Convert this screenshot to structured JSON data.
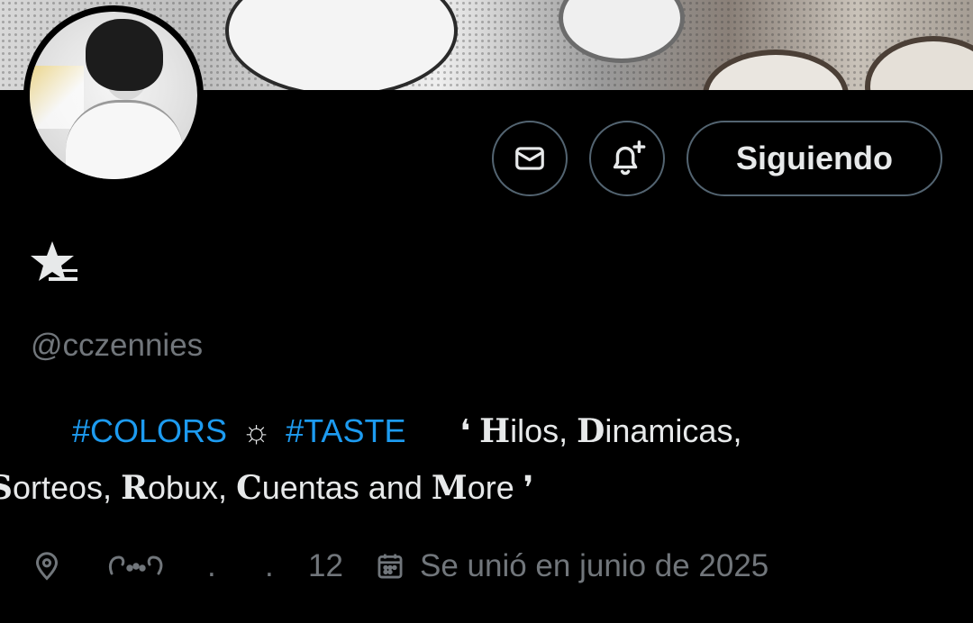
{
  "profile": {
    "display_name": "★",
    "handle": "@cczennies",
    "bio": {
      "tag1": "#COLORS",
      "separator": "☼",
      "tag2": "#TASTE",
      "open_quote": "❛",
      "line1_parts": [
        "H",
        "ilos, ",
        "D",
        "inamicas,"
      ],
      "line2_parts": [
        "S",
        "orteos, ",
        "R",
        "obux, ",
        "C",
        "uentas and ",
        "M",
        "ore"
      ],
      "close_quote": "❜"
    },
    "meta": {
      "location_text": ". .",
      "location_dot1": ".",
      "location_dot2": ".",
      "location_number": "12",
      "joined": "Se unió en junio de 2025"
    }
  },
  "actions": {
    "message_icon": "envelope-icon",
    "notify_icon": "bell-plus-icon",
    "follow_label": "Siguiendo"
  },
  "colors": {
    "background": "#000000",
    "text": "#e7e9ea",
    "secondary": "#71767b",
    "link": "#1d9bf0",
    "border": "#536471"
  }
}
